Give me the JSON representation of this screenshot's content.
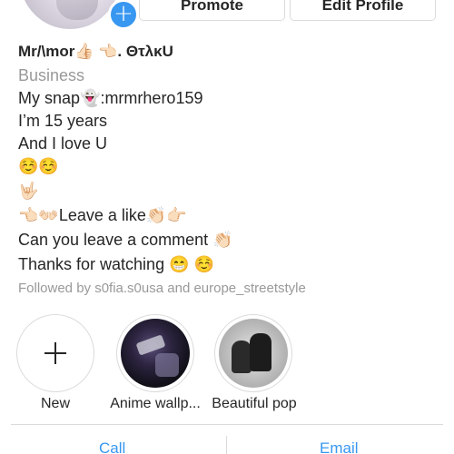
{
  "profile": {
    "name": "Mr/\\mor👍🏻 👈🏻.    ΘτλκU",
    "category": "Business",
    "bio": [
      "My snap👻:mrmrhero159",
      "I’m 15 years",
      "And I love U",
      "☺️☺️",
      "🤟🏻",
      "👈🏻👐🏻Leave a like👏🏻👉🏻",
      "Can you leave a comment 👏🏻",
      "Thanks for watching 😁 ☺️"
    ],
    "followed_by": "Followed by s0fia.s0usa and europe_streetstyle"
  },
  "buttons": {
    "promote": "Promote",
    "edit_profile": "Edit Profile"
  },
  "avatar": {
    "add_badge": "+"
  },
  "highlights": [
    {
      "label": "New",
      "icon": "plus-icon"
    },
    {
      "label": "Anime wallp...",
      "icon": "highlight-cover-image"
    },
    {
      "label": "Beautiful pop",
      "icon": "highlight-cover-image"
    }
  ],
  "actions": {
    "call": "Call",
    "email": "Email"
  },
  "colors": {
    "accent": "#3897f0",
    "text": "#262626",
    "muted": "#999999",
    "border": "#dbdbdb"
  }
}
